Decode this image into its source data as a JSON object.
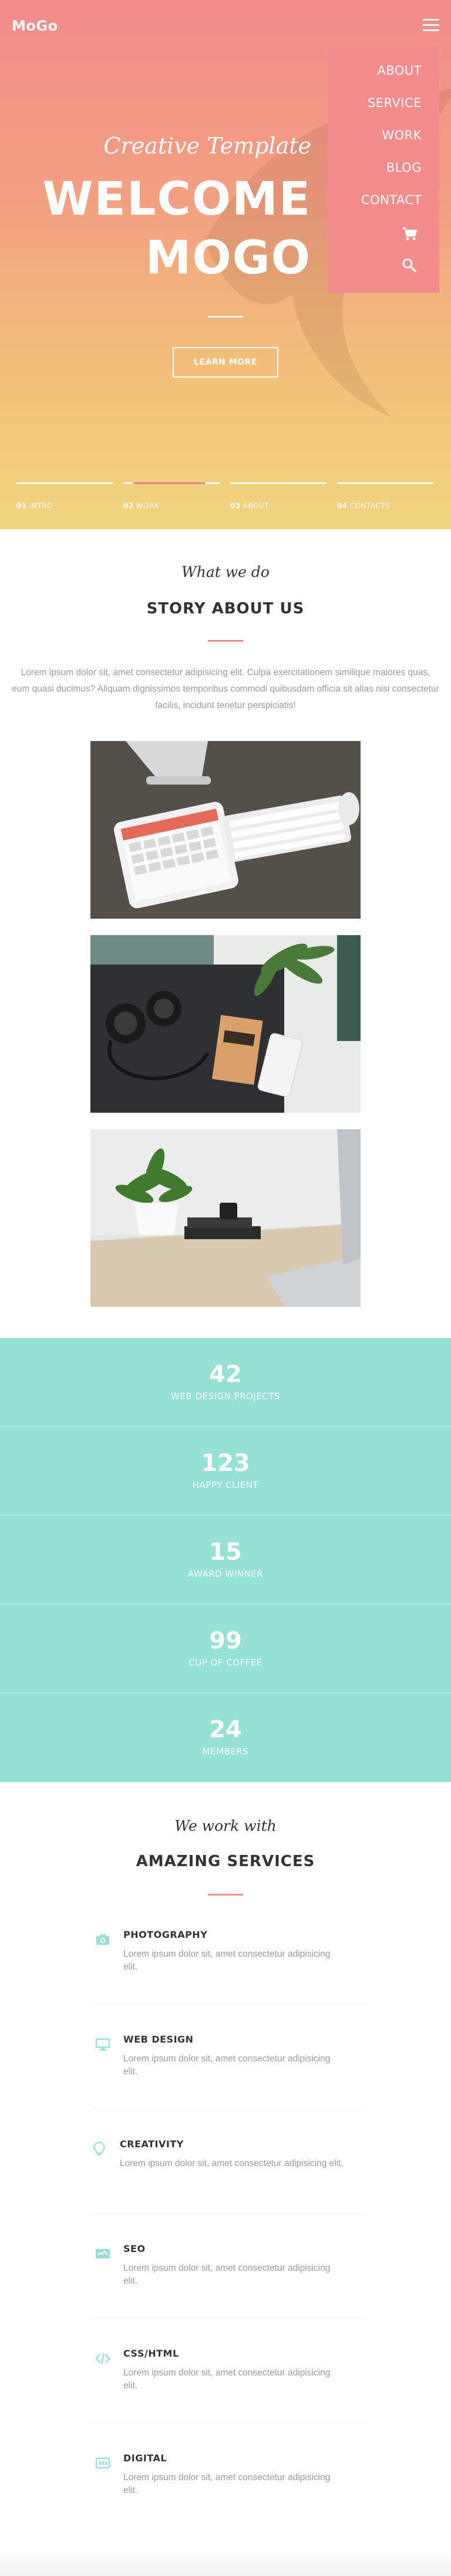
{
  "header": {
    "logo": "MoGo",
    "menu_icon": "hamburger-icon"
  },
  "nav": {
    "items": [
      {
        "label": "ABOUT"
      },
      {
        "label": "SERVICE"
      },
      {
        "label": "WORK"
      },
      {
        "label": "BLOG"
      },
      {
        "label": "CONTACT"
      }
    ],
    "cart_icon": "cart-icon",
    "search_icon": "search-icon",
    "background": "#f28b8b"
  },
  "hero": {
    "subtitle": "Creative Template",
    "title_line1": "WELCOME",
    "title_line2": "MOGO",
    "button": "LEARN MORE",
    "gradient": [
      "#f28b8b",
      "#f1d57e"
    ],
    "slides": [
      {
        "num": "01",
        "label": "INTRO"
      },
      {
        "num": "02",
        "label": "WORK"
      },
      {
        "num": "03",
        "label": "ABOUT"
      },
      {
        "num": "04",
        "label": "CONTACTS"
      }
    ],
    "active_slide": 1
  },
  "about": {
    "script": "What we do",
    "title": "STORY ABOUT US",
    "text": "Lorem ipsum dolor sit, amet consectetur adipisicing elit. Culpa exercitationem similique maiores quas, eum quasi ducimus? Aliquam dignissimos temporibus commodi quibusdam officia sit alias nisi consectetur facilis, incidunt tenetur perspiciatis!",
    "accent": "#f28b8b"
  },
  "stats": {
    "background": "#95e1d3",
    "items": [
      {
        "number": "42",
        "label": "WEB DESIGN PROJECTS"
      },
      {
        "number": "123",
        "label": "HAPPY CLIENT"
      },
      {
        "number": "15",
        "label": "AWARD WINNER"
      },
      {
        "number": "99",
        "label": "CUP OF COFFEE"
      },
      {
        "number": "24",
        "label": "MEMBERS"
      }
    ]
  },
  "services": {
    "script": "We work with",
    "title": "AMAZING SERVICES",
    "icon_color": "#95e1d3",
    "items": [
      {
        "icon": "camera-icon",
        "title": "PHOTOGRAPHY",
        "text": "Lorem ipsum dolor sit, amet consectetur adipisicing elit."
      },
      {
        "icon": "monitor-icon",
        "title": "WEB DESIGN",
        "text": "Lorem ipsum dolor sit, amet consectetur adipisicing elit."
      },
      {
        "icon": "lightbulb-icon",
        "title": "CREATIVITY",
        "text": "Lorem ipsum dolor sit, amet consectetur adipisicing elit."
      },
      {
        "icon": "seo-icon",
        "title": "SEO",
        "text": "Lorem ipsum dolor sit, amet consectetur adipisicing elit."
      },
      {
        "icon": "code-icon",
        "title": "CSS/HTML",
        "text": "Lorem ipsum dolor sit, amet consectetur adipisicing elit."
      },
      {
        "icon": "digital-icon",
        "title": "DIGITAL",
        "text": "Lorem ipsum dolor sit, amet consectetur adipisicing elit."
      }
    ]
  }
}
